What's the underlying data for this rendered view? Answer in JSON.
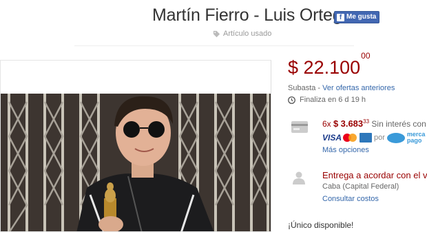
{
  "listing": {
    "title": "Martín Fierro - Luis Ortega",
    "like_label": "Me gusta",
    "condition": "Artículo usado"
  },
  "price": {
    "currency": "$",
    "integer": "22.100",
    "cents": "00"
  },
  "auction": {
    "type": "Subasta",
    "separator": " - ",
    "bids_link": "Ver ofertas anteriores",
    "ends": "Finaliza en 6 d 19 h"
  },
  "payment": {
    "installments_count": "6x",
    "installment_currency": "$",
    "installment_integer": "3.683",
    "installment_cents": "33",
    "no_interest": "Sin interés con",
    "visa_label": "VISA",
    "por": "por",
    "mp_line1": "merca",
    "mp_line2": "pago",
    "more_options": "Más opciones"
  },
  "shipping": {
    "delivery": "Entrega a acordar con el ve",
    "location": "Caba (Capital Federal)",
    "costs_link": "Consultar costos"
  },
  "stock": {
    "label": "¡Único disponible!"
  },
  "colors": {
    "price_red": "#990000",
    "link_blue": "#3366aa",
    "facebook_blue": "#4267b2"
  }
}
